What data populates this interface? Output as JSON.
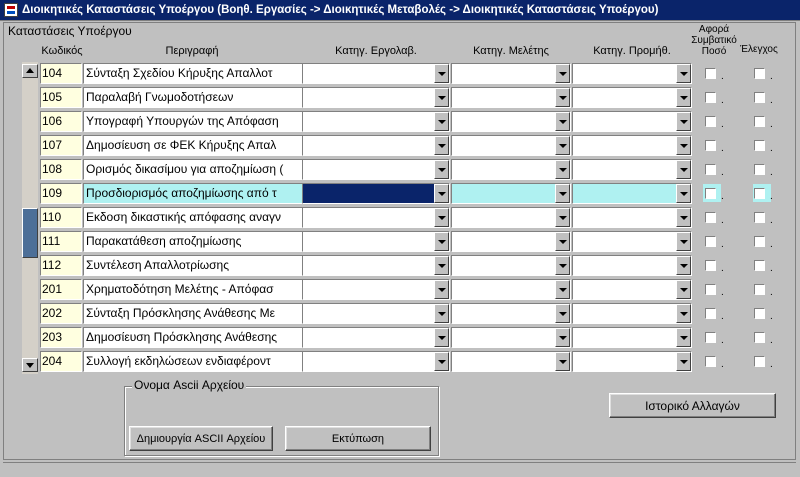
{
  "window": {
    "title": "Διοικητικές Καταστάσεις Υποέργου (Βοηθ. Εργασίες -> Διοικητικές Μεταβολές -> Διοικητικές Καταστάσεις Υποέργου)"
  },
  "section": {
    "label": "Καταστάσεις Υποέργου"
  },
  "columns": {
    "code": "Κωδικός",
    "description": "Περιγραφή",
    "cat_contractor": "Κατηγ. Εργολαβ.",
    "cat_study": "Κατηγ. Μελέτης",
    "cat_supply": "Κατηγ. Προμήθ.",
    "contract_amount_1": "Αφορά",
    "contract_amount_2": "Συμβατικό",
    "contract_amount_3": "Ποσό",
    "control": "Έλεγχος"
  },
  "rows": [
    {
      "code": "104",
      "description": "Σύνταξη Σχεδίου Κήρυξης Απαλλοτ"
    },
    {
      "code": "105",
      "description": "Παραλαβή Γνωμοδοτήσεων"
    },
    {
      "code": "106",
      "description": "Υπογραφή Υπουργών της Απόφαση"
    },
    {
      "code": "107",
      "description": "Δημοσίευση σε ΦΕΚ Κήρυξης Απαλ"
    },
    {
      "code": "108",
      "description": "Ορισμός δικασίμου για αποζημίωση ("
    },
    {
      "code": "109",
      "description": "Προσδιορισμός αποζημίωσης από τ"
    },
    {
      "code": "110",
      "description": "Εκδοση δικαστικής απόφασης αναγν"
    },
    {
      "code": "111",
      "description": "Παρακατάθεση αποζημίωσης"
    },
    {
      "code": "112",
      "description": "Συντέλεση Απαλλοτρίωσης"
    },
    {
      "code": "201",
      "description": "Χρηματοδότηση Μελέτης - Απόφασ"
    },
    {
      "code": "202",
      "description": "Σύνταξη Πρόσκλησης Ανάθεσης Με"
    },
    {
      "code": "203",
      "description": "Δημοσίευση Πρόσκλησης Ανάθεσης"
    },
    {
      "code": "204",
      "description": "Συλλογή εκδηλώσεων ενδιαφέροντ"
    }
  ],
  "current_row_index": 5,
  "ascii_group": {
    "label": "Ονομα Ascii Αρχείου"
  },
  "buttons": {
    "create_ascii": "Δημιουργία  ASCII Αρχείου",
    "print": "Εκτύπωση",
    "history": "Ιστορικό Αλλαγών"
  },
  "colors": {
    "titlebar": "#0a246a",
    "current_row": "#aff1f1",
    "code_cell": "#ffffe0"
  }
}
